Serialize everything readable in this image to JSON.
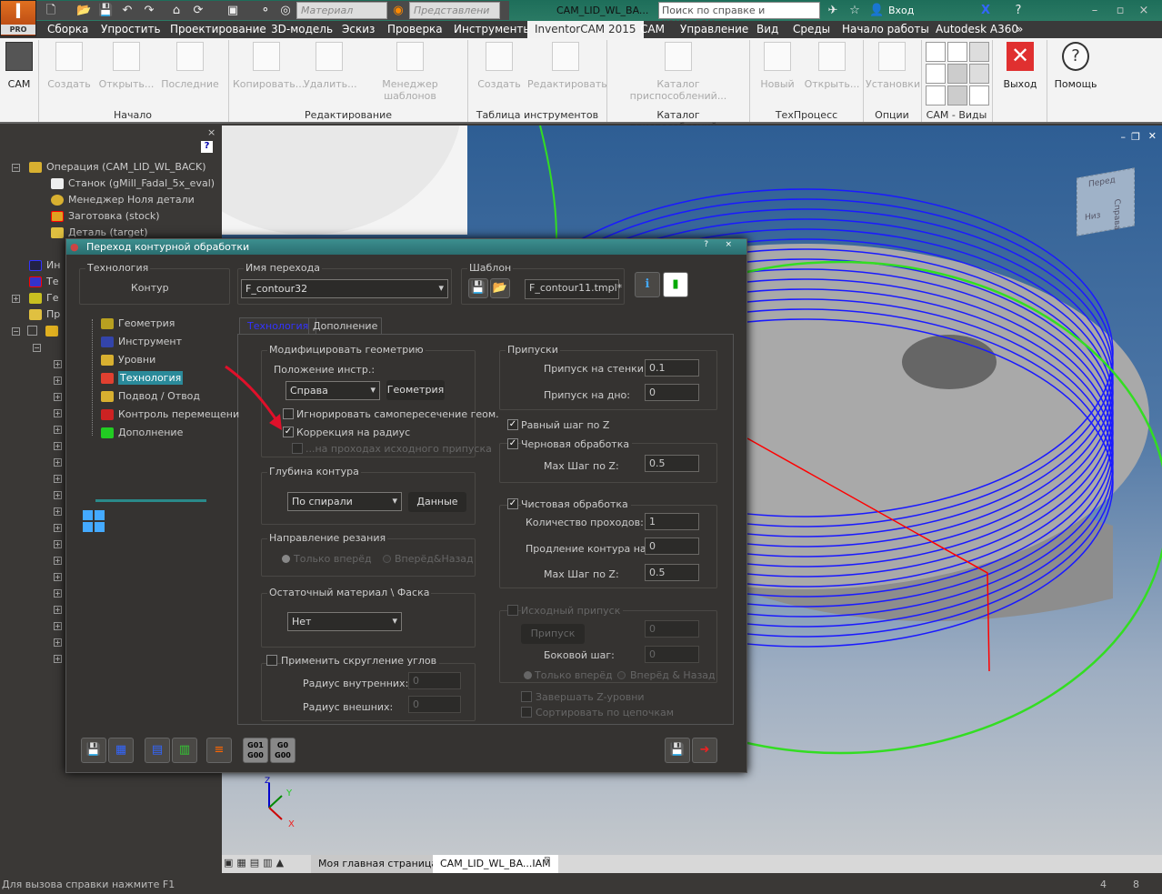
{
  "app": {
    "logo_label": "PRO",
    "title": "CAM_LID_WL_BA..."
  },
  "qat": {
    "material": "Материал",
    "appearance": "Представлени",
    "search_placeholder": "Поиск по справке и командам..",
    "signin": "Вход"
  },
  "tabs": [
    "Сборка",
    "Упростить",
    "Проектирование",
    "3D-модель",
    "Эскиз",
    "Проверка",
    "Инструменты",
    "InventorCAM 2015",
    "CAM",
    "Управление",
    "Вид",
    "Среды",
    "Начало работы",
    "Autodesk A360"
  ],
  "active_tab": "InventorCAM 2015",
  "ribbon": {
    "cam": "CAM",
    "start": {
      "items": [
        "Создать",
        "Открыть...",
        "Последние"
      ],
      "label": "Начало"
    },
    "edit": {
      "items": [
        "Копировать...",
        "Удалить...",
        "Менеджер шаблонов"
      ],
      "label": "Редактирование"
    },
    "tools": {
      "items": [
        "Создать",
        "Редактировать"
      ],
      "label": "Таблица инструментов"
    },
    "fixtures": {
      "items": [
        "Каталог приспособлений..."
      ],
      "label": "Каталог приспособлений..."
    },
    "process": {
      "items": [
        "Новый",
        "Открыть..."
      ],
      "label": "ТехПроцесс"
    },
    "options": {
      "items": [
        "Установки"
      ],
      "label": "Опции"
    },
    "views": {
      "label": "CAM - Виды"
    },
    "exit": "Выход",
    "help": "Помощь"
  },
  "tree": {
    "root": "Операция (CAM_LID_WL_BACK)",
    "children": [
      "Станок (gMill_Fadal_5x_eval)",
      "Менеджер Ноля детали",
      "Заготовка (stock)",
      "Деталь (target)"
    ],
    "partial": [
      "Ин",
      "Те",
      "Ге",
      "Пр"
    ]
  },
  "dialog": {
    "title": "Переход контурной обработки",
    "tech_group": "Технология",
    "tech_value": "Контур",
    "name_group": "Имя перехода",
    "name_value": "F_contour32",
    "template_group": "Шаблон",
    "template_value": "F_contour11.tmpl*",
    "nav": [
      "Геометрия",
      "Инструмент",
      "Уровни",
      "Технология",
      "Подвод / Отвод",
      "Контроль перемещени",
      "Дополнение"
    ],
    "nav_selected": "Технология",
    "subtabs": [
      "Технология",
      "Дополнение"
    ],
    "modify": {
      "title": "Модифицировать геометрию",
      "tool_pos_label": "Положение инстр.:",
      "tool_pos_value": "Справа",
      "geometry_btn": "Геометрия",
      "ignore": {
        "label": "Игнорировать самопересечение геом.",
        "checked": false
      },
      "comp": {
        "label": "Коррекция на радиус",
        "checked": true
      },
      "comp_passes": {
        "label": "...на проходах исходного припуска",
        "checked": false,
        "disabled": true
      }
    },
    "depth": {
      "title": "Глубина контура",
      "value": "По спирали",
      "data_btn": "Данные"
    },
    "direction": {
      "title": "Направление резания",
      "options": [
        "Только вперёд",
        "Вперёд&Назад"
      ],
      "selected": "Только вперёд"
    },
    "rest": {
      "title": "Остаточный материал \\ Фаска",
      "value": "Нет"
    },
    "fillet": {
      "label": "Применить скругление углов",
      "checked": false,
      "inner_label": "Радиус внутренних:",
      "inner": "0",
      "outer_label": "Радиус внешних:",
      "outer": "0"
    },
    "allow": {
      "title": "Припуски",
      "wall_label": "Припуск на стенки:",
      "wall": "0.1",
      "floor_label": "Припуск на дно:",
      "floor": "0"
    },
    "equal_step": {
      "label": "Равный шаг по Z",
      "checked": true
    },
    "rough": {
      "label": "Черновая обработка",
      "checked": true,
      "step_label": "Max Шаг по Z:",
      "step": "0.5"
    },
    "finish": {
      "label": "Чистовая обработка",
      "checked": true,
      "passes_label": "Количество проходов:",
      "passes": "1",
      "ext_label": "Продление контура на:",
      "ext": "0",
      "step_label": "Max Шаг по Z:",
      "step": "0.5"
    },
    "initial": {
      "label": "Исходный припуск",
      "checked": false,
      "btn": "Припуск",
      "val": "0",
      "side_label": "Боковой шаг:",
      "side": "0",
      "options": [
        "Только вперёд",
        "Вперёд & Назад"
      ]
    },
    "complete_z": {
      "label": "Завершать Z-уровни",
      "checked": false
    },
    "sort": {
      "label": "Сортировать по цепочкам",
      "checked": false
    },
    "gcode": [
      "G01 G00",
      "G0 G00"
    ]
  },
  "viewcube": {
    "faces": [
      "Перед",
      "Справа",
      "Низ"
    ]
  },
  "axes": {
    "x": "X",
    "y": "Y",
    "z": "Z"
  },
  "doctabs": [
    "Моя главная страница",
    "CAM_LID_WL_BA...IAM"
  ],
  "status": {
    "text": "Для вызова справки нажмите F1",
    "n1": "4",
    "n2": "8"
  },
  "colors": {
    "toolpath": "#1a1aff",
    "contour": "#33dd22",
    "accent": "#2f8f8f",
    "selected": "#2a8a9a"
  }
}
